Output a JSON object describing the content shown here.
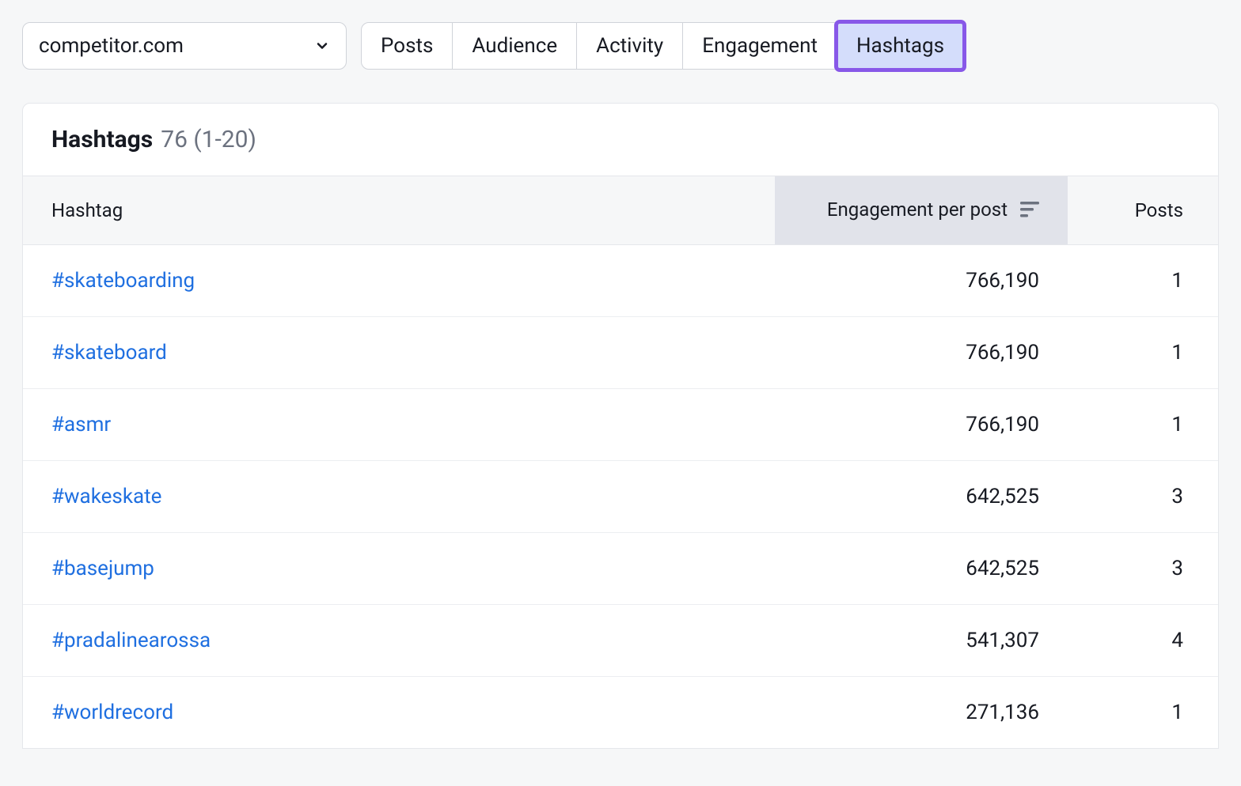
{
  "domainSelector": {
    "value": "competitor.com"
  },
  "tabs": [
    {
      "label": "Posts",
      "active": false
    },
    {
      "label": "Audience",
      "active": false
    },
    {
      "label": "Activity",
      "active": false
    },
    {
      "label": "Engagement",
      "active": false
    },
    {
      "label": "Hashtags",
      "active": true
    }
  ],
  "panel": {
    "title": "Hashtags",
    "countText": "76 (1-20)"
  },
  "columns": {
    "hashtag": "Hashtag",
    "engagementPerPost": "Engagement per post",
    "posts": "Posts"
  },
  "rows": [
    {
      "hashtag": "#skateboarding",
      "epp": "766,190",
      "posts": "1"
    },
    {
      "hashtag": "#skateboard",
      "epp": "766,190",
      "posts": "1"
    },
    {
      "hashtag": "#asmr",
      "epp": "766,190",
      "posts": "1"
    },
    {
      "hashtag": "#wakeskate",
      "epp": "642,525",
      "posts": "3"
    },
    {
      "hashtag": "#basejump",
      "epp": "642,525",
      "posts": "3"
    },
    {
      "hashtag": "#pradalinearossa",
      "epp": "541,307",
      "posts": "4"
    },
    {
      "hashtag": "#worldrecord",
      "epp": "271,136",
      "posts": "1"
    }
  ]
}
